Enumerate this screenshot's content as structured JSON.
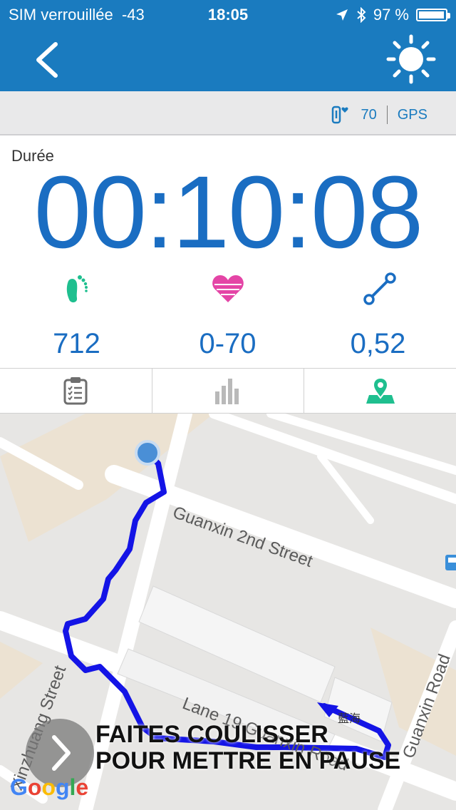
{
  "status_bar": {
    "carrier": "SIM verrouillée",
    "signal": "-43",
    "time": "18:05",
    "battery_percent": "97 %",
    "battery_level": 0.97
  },
  "info_bar": {
    "heart_value": "70",
    "gps_label": "GPS"
  },
  "workout": {
    "duration_label": "Durée",
    "duration": "00:10:08",
    "steps": "712",
    "heart_rate": "0-70",
    "distance": "0,52"
  },
  "map": {
    "streets": [
      "Guanxin 2nd Street",
      "Xinzhuang Street",
      "Lane 19 Guanxin Road",
      "Guanxin Road"
    ],
    "poi_label": "藍海",
    "attribution": "Google"
  },
  "pause": {
    "line1": "FAITES COULISSER",
    "line2": "POUR METTRE EN PAUSE"
  },
  "colors": {
    "header": "#1a7bbf",
    "primary_text": "#1a6dc2",
    "steps_icon": "#1fbf8f",
    "heart_icon": "#e445a6",
    "route": "#1414e6"
  }
}
